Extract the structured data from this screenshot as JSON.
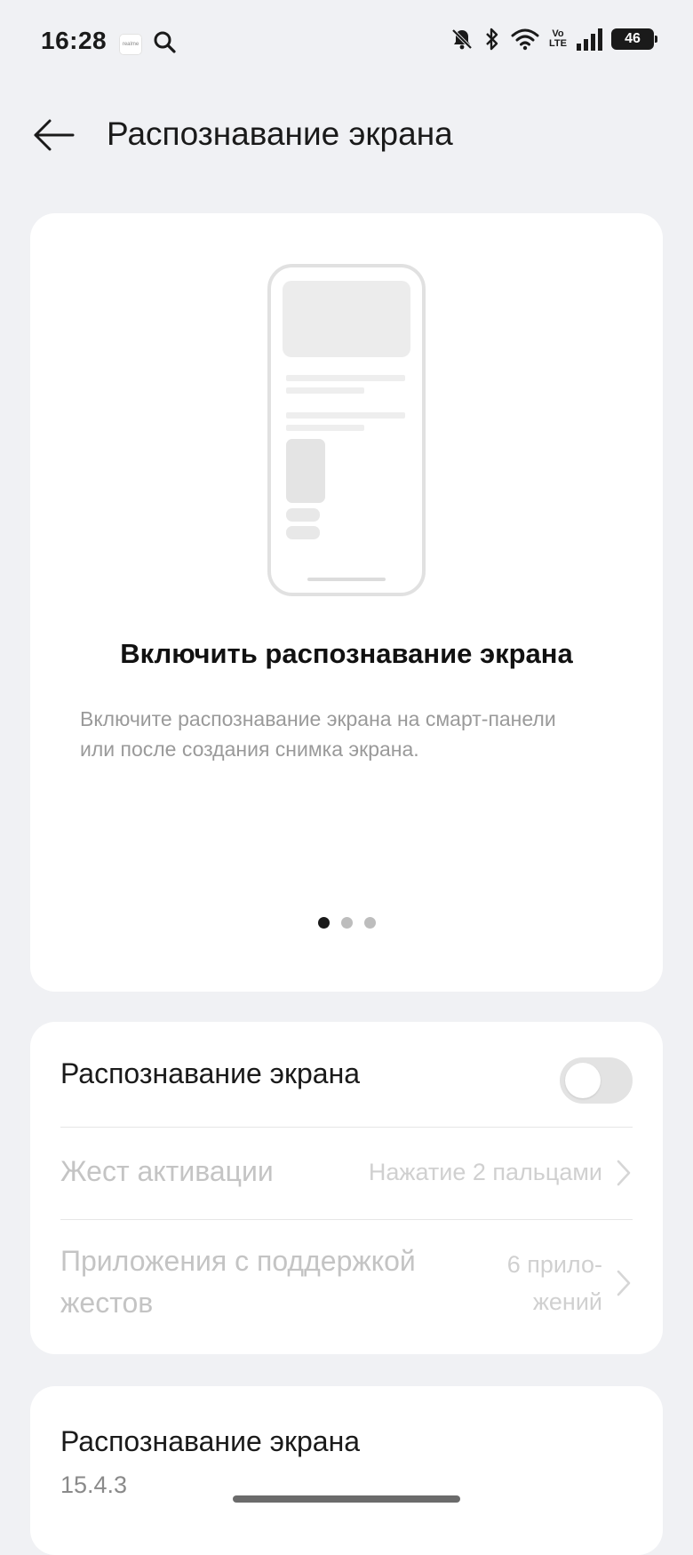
{
  "status_bar": {
    "time": "16:28",
    "mini_app_label": "realme",
    "volte_top": "Vo",
    "volte_bottom": "LTE",
    "battery": "46"
  },
  "header": {
    "title": "Распознавание экрана"
  },
  "onboarding": {
    "title": "Включить распознавание экрана",
    "description": "Включите распознавание экрана на смарт-панели или после создания снимка экрана.",
    "pages": 3,
    "active_page": 1
  },
  "settings": {
    "toggle_label": "Распознавание экрана",
    "toggle_on": false,
    "gesture_label": "Жест активации",
    "gesture_value": "Нажатие 2 пальцами",
    "apps_label_line1": "Приложения с поддержкой",
    "apps_label_line2": "жестов",
    "apps_value_line1": "6 прило-",
    "apps_value_line2": "жений"
  },
  "info": {
    "title": "Распознавание экрана",
    "version": "15.4.3"
  }
}
